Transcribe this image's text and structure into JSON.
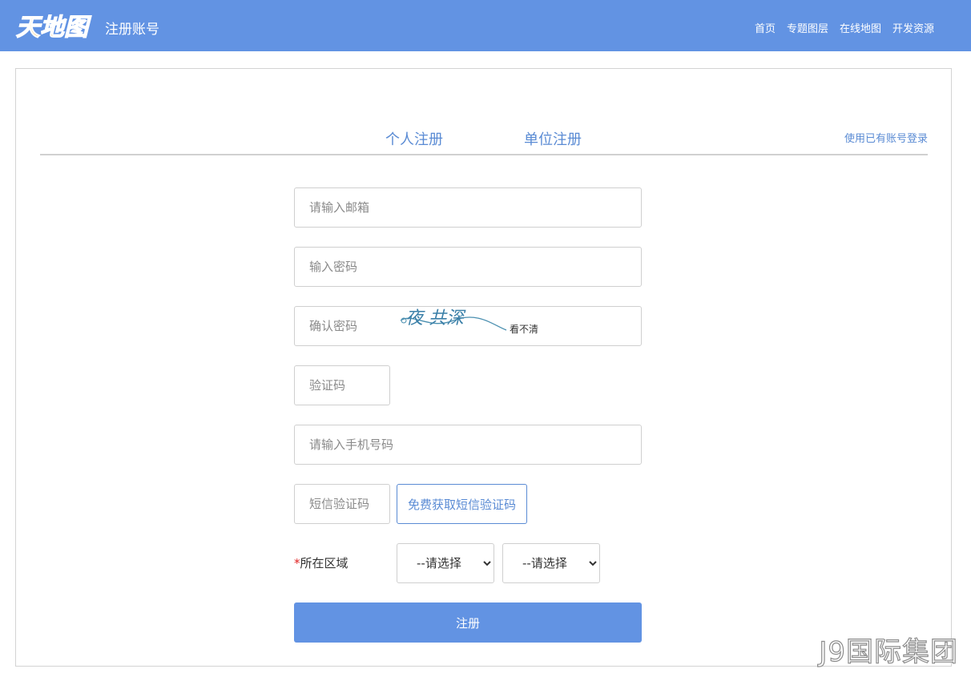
{
  "header": {
    "logo_text": "天地图",
    "title": "注册账号",
    "nav": [
      "首页",
      "专题图层",
      "在线地图",
      "开发资源"
    ]
  },
  "tabs": {
    "personal": "个人注册",
    "organization": "单位注册",
    "active": "personal"
  },
  "login_link": "使用已有账号登录",
  "form": {
    "email_placeholder": "请输入邮箱",
    "password_placeholder": "输入密码",
    "confirm_placeholder": "确认密码",
    "captcha_placeholder": "验证码",
    "captcha_image_text": "夜 共深",
    "captcha_refresh": "看不清",
    "phone_placeholder": "请输入手机号码",
    "sms_placeholder": "短信验证码",
    "sms_button": "免费获取短信验证码",
    "region_required_mark": "*",
    "region_label": "所在区域",
    "region_select_1": "--请选择",
    "region_select_2": "--请选择",
    "submit": "注册"
  },
  "watermark": "J9国际集团",
  "colors": {
    "header_bg": "#6293e3",
    "accent": "#5a8bd4",
    "logo_orange": "#f39c12"
  }
}
